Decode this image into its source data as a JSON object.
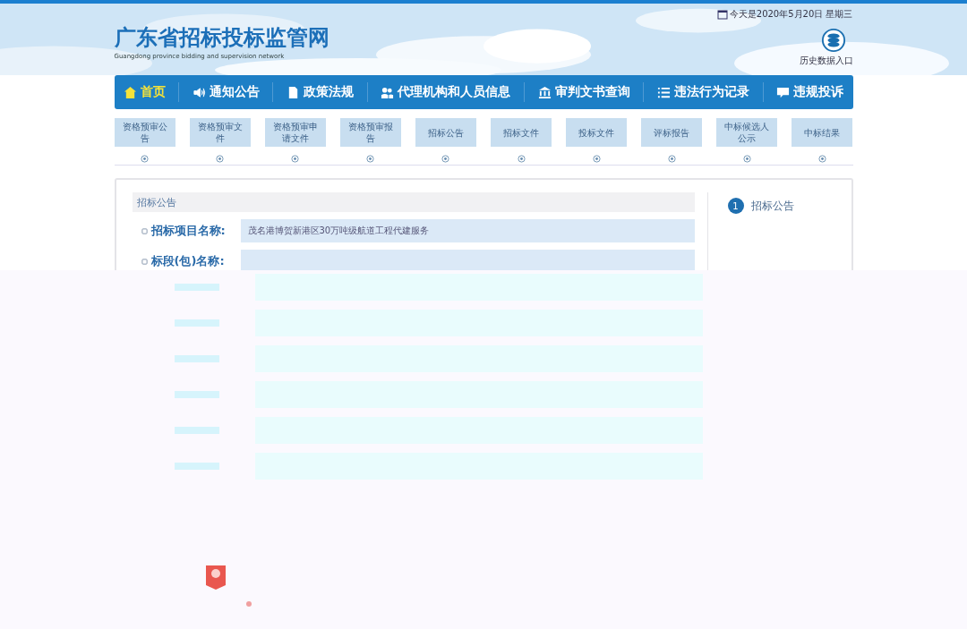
{
  "header": {
    "title": "广东省招标投标监管网",
    "subtitle": "Guangdong province bidding and supervision network",
    "date": "今天是2020年5月20日 星期三",
    "archive_link": "历史数据入口"
  },
  "nav": [
    {
      "label": "首页",
      "selected": true
    },
    {
      "label": "通知公告",
      "selected": false
    },
    {
      "label": "政策法规",
      "selected": false
    },
    {
      "label": "代理机构和人员信息",
      "selected": false
    },
    {
      "label": "审判文书查询",
      "selected": false
    },
    {
      "label": "违法行为记录",
      "selected": false
    },
    {
      "label": "违规投诉",
      "selected": false
    }
  ],
  "steps": [
    {
      "label": "资格预审公告"
    },
    {
      "label": "资格预审文件"
    },
    {
      "label": "资格预审申请文件"
    },
    {
      "label": "资格预审报告"
    },
    {
      "label": "招标公告"
    },
    {
      "label": "招标文件"
    },
    {
      "label": "投标文件"
    },
    {
      "label": "评标报告"
    },
    {
      "label": "中标候选人公示"
    },
    {
      "label": "中标结果"
    }
  ],
  "panel": {
    "title": "招标公告",
    "fields": [
      {
        "label": "招标项目名称:",
        "value": "茂名港博贺新港区30万吨级航道工程代建服务"
      },
      {
        "label": "标段(包)名称:"
      }
    ]
  },
  "side_steps": [
    {
      "number": "1",
      "label": "招标公告"
    }
  ]
}
